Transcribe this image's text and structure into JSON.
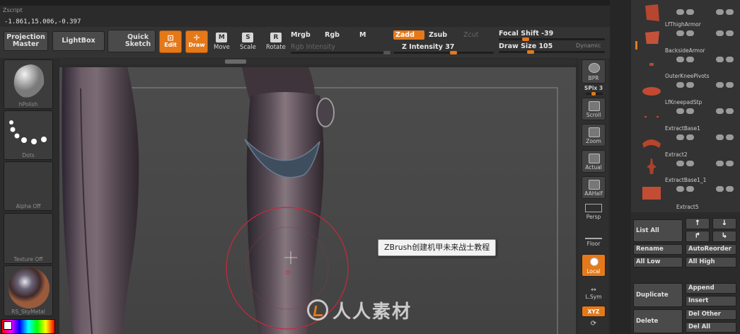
{
  "header": {
    "script_label": "Zscript",
    "coordinates": "-1.861,15.006,-0.397"
  },
  "toolbar": {
    "projection_master": "Projection Master",
    "lightbox": "LightBox",
    "quick_sketch": "Quick Sketch",
    "edit": "Edit",
    "draw": "Draw",
    "move": "Move",
    "scale": "Scale",
    "rotate": "Rotate",
    "mrgb": "Mrgb",
    "rgb": "Rgb",
    "m": "M",
    "zadd": "Zadd",
    "zsub": "Zsub",
    "zcut": "Zcut",
    "rgb_intensity": "Rgb Intensity",
    "z_intensity": "Z Intensity 37",
    "focal_shift": "Focal Shift -39",
    "draw_size": "Draw Size 105",
    "dynamic": "Dynamic"
  },
  "left_shelf": {
    "brush": "hPolish",
    "stroke": "Dots",
    "alpha": "Alpha Off",
    "texture": "Texture Off",
    "material": "RS_SkyMetal"
  },
  "right_column": {
    "bpr": "BPR",
    "spix": "SPix 3",
    "scroll": "Scroll",
    "zoom": "Zoom",
    "actual": "Actual",
    "aahalf": "AAHalf",
    "persp": "Persp",
    "floor": "Floor",
    "local": "Local",
    "lsym": "L.Sym",
    "xyz": "XYZ"
  },
  "subtools": [
    {
      "name": "",
      "thumb_color": "#b6462f"
    },
    {
      "name": "LfThighArmor",
      "thumb_color": "#c4523a"
    },
    {
      "name": "BacksideArmor",
      "thumb_color": "#b9462e"
    },
    {
      "name": "OuterKneePivots",
      "thumb_color": "#c34a32"
    },
    {
      "name": "LfKneepadStp",
      "thumb_color": "#c04d36"
    },
    {
      "name": "ExtractBase1",
      "thumb_color": "#b8442c"
    },
    {
      "name": "Extract2",
      "thumb_color": "#a8412c"
    },
    {
      "name": "ExtractBase1_1",
      "thumb_color": "#c34d34"
    },
    {
      "name": "Extract5",
      "thumb_color": "#5b5b5b"
    }
  ],
  "subtool_panel": {
    "list_all": "List All",
    "rename": "Rename",
    "autoreorder": "AutoReorder",
    "all_low": "All Low",
    "all_high": "All High",
    "duplicate": "Duplicate",
    "append": "Append",
    "insert": "Insert",
    "delete": "Delete",
    "del_other": "Del Other",
    "del_all": "Del All"
  },
  "tooltip": "ZBrush创建机甲未来战士教程",
  "watermark": "人人素材",
  "colors": {
    "accent": "#e5791a",
    "brush_ring": "#c8283c"
  }
}
